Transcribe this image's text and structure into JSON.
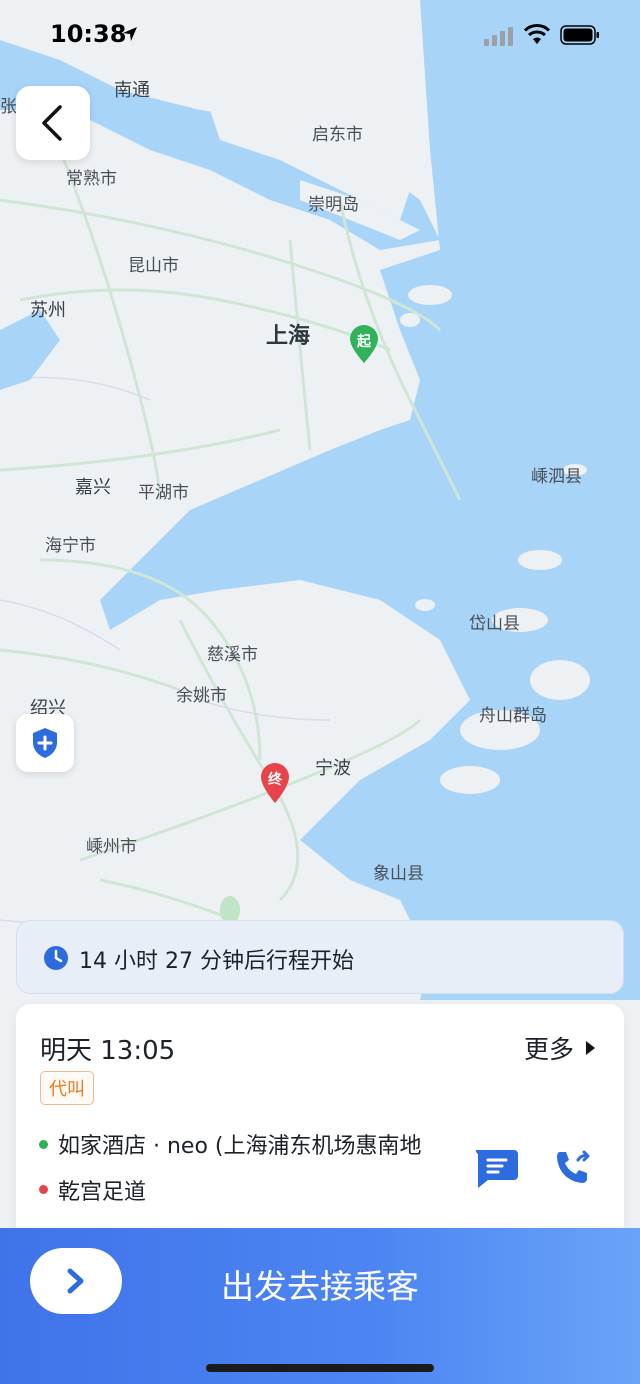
{
  "status_bar": {
    "time": "10:38"
  },
  "map": {
    "labels": {
      "nantong": "南通",
      "qidong": "启东市",
      "changshu": "常熟市",
      "chongming": "崇明岛",
      "kunshan": "昆山市",
      "suzhou": "苏州",
      "shanghai": "上海",
      "shengsi": "嵊泗县",
      "jiaxing": "嘉兴",
      "pinghu": "平湖市",
      "haining": "海宁市",
      "daishan": "岱山县",
      "cixi": "慈溪市",
      "yuyao": "余姚市",
      "shaoxing": "绍兴",
      "zhoushan": "舟山群岛",
      "ningbo": "宁波",
      "shengzhou": "嵊州市",
      "xiangshan": "象山县",
      "zhang": "张"
    },
    "start_pin": "起",
    "end_pin": "终"
  },
  "trip_notice": {
    "text": "14 小时 27 分钟后行程开始"
  },
  "order_card": {
    "time": "明天 13:05",
    "more_label": "更多",
    "tag": "代叫",
    "pickup": "如家酒店 · neo (上海浦东机场惠南地",
    "dropoff": "乾宫足道"
  },
  "action": {
    "label": "出发去接乘客"
  },
  "colors": {
    "primary": "#3f73ea",
    "start": "#2fb25a",
    "end": "#e8424a",
    "tag": "#ef7a1e"
  }
}
